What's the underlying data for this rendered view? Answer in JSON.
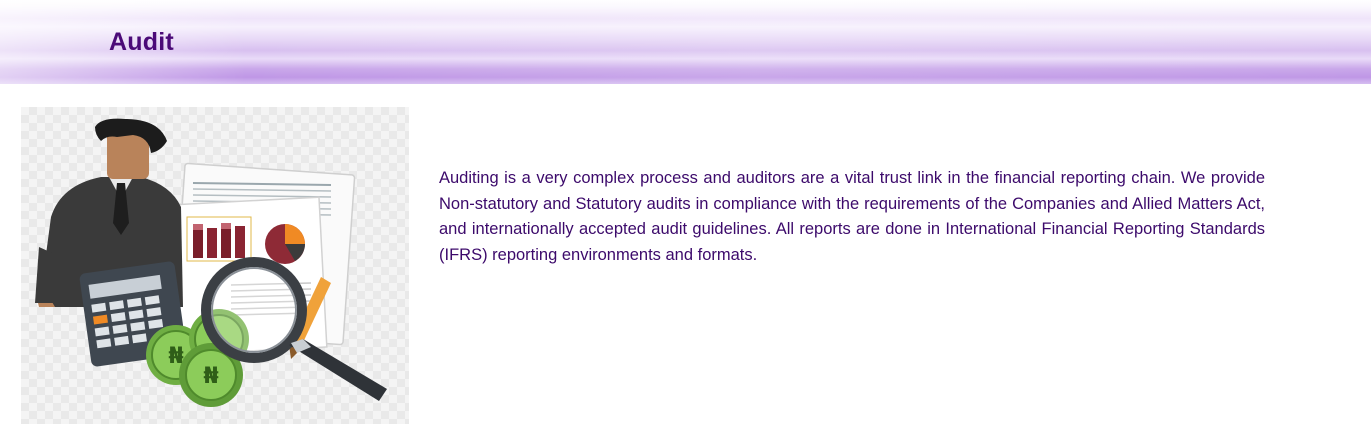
{
  "header": {
    "title": "Audit"
  },
  "illustration": {
    "icons": [
      "businessman-icon",
      "calculator-icon",
      "report-document-icon",
      "bar-chart-icon",
      "pie-chart-icon",
      "magnifying-glass-icon",
      "naira-coin-icon",
      "pencil-icon"
    ],
    "coin_symbol": "₦"
  },
  "content": {
    "description": "Auditing is a very complex process and auditors are a vital trust link in the financial reporting chain. We provide Non-statutory and Statutory audits in compliance with the requirements of the Companies and Allied Matters Act, and  internationally accepted audit guidelines. All reports are done in International Financial Reporting Standards (IFRS) reporting environments and formats."
  },
  "colors": {
    "title": "#4b0a78",
    "body_text": "#3c0a6b",
    "banner_accent": "#c9a7ea",
    "coin_green": "#7cc04b"
  }
}
